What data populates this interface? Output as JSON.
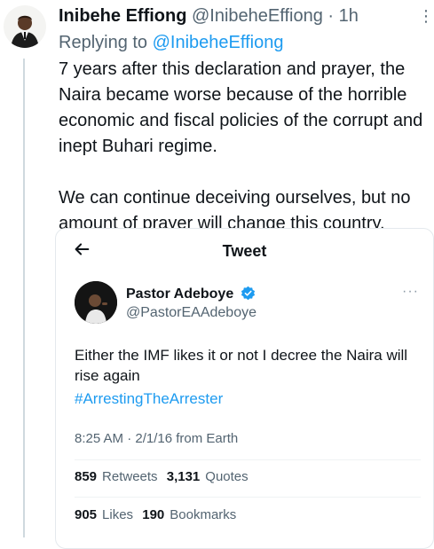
{
  "post": {
    "display_name": "Inibehe Effiong",
    "handle": "@InibeheEffiong",
    "separator": "·",
    "time": "1h",
    "replying_prefix": "Replying to",
    "replying_to": "@InibeheEffiong",
    "text": "7 years after this declaration and prayer, the Naira became worse because of the horrible economic and fiscal policies of the corrupt and inept Buhari regime.\n\nWe can continue deceiving ourselves, but no amount of prayer will change this country."
  },
  "quoted": {
    "header_title": "Tweet",
    "display_name": "Pastor Adeboye",
    "handle": "@PastorEAAdeboye",
    "text": "Either the IMF likes it or not I decree the Naira will rise again",
    "hashtag": "#ArrestingTheArrester",
    "meta": "8:25 AM · 2/1/16 from Earth",
    "stats": {
      "retweets_count": "859",
      "retweets_label": "Retweets",
      "quotes_count": "3,131",
      "quotes_label": "Quotes",
      "likes_count": "905",
      "likes_label": "Likes",
      "bookmarks_count": "190",
      "bookmarks_label": "Bookmarks"
    }
  },
  "icons": {
    "verified": "verified-badge-icon",
    "back": "back-arrow-icon",
    "more": "more-options-icon"
  },
  "colors": {
    "accent": "#1d9bf0",
    "text": "#0f1419",
    "muted": "#536471"
  }
}
